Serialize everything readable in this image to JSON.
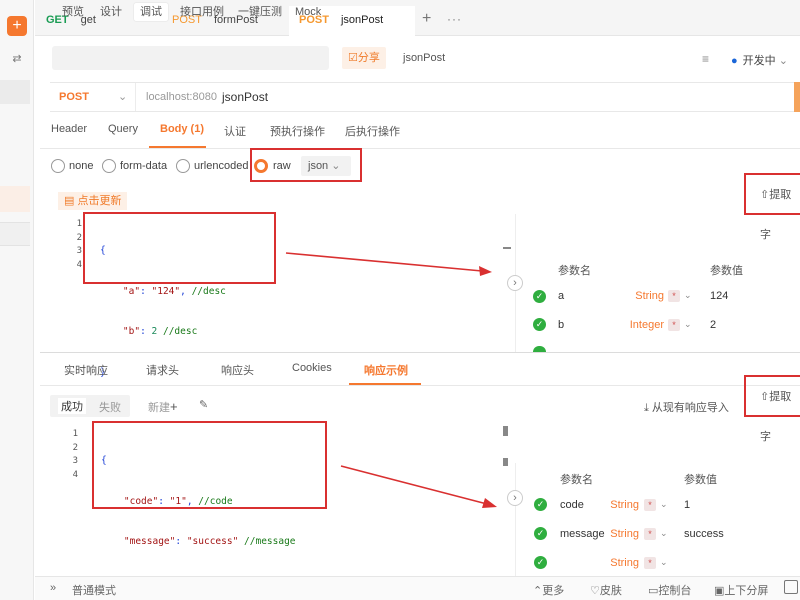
{
  "rail": {
    "add_icon": "plus-icon",
    "tool_icon": "sliders-icon"
  },
  "tabs": [
    {
      "method": "GET",
      "name": "get"
    },
    {
      "method": "POST",
      "name": "formPost"
    },
    {
      "method": "POST",
      "name": "jsonPost"
    }
  ],
  "tab_add": "+",
  "tab_more": "···",
  "modes": [
    "预览",
    "设计",
    "调试",
    "接口用例",
    "一键压测",
    "Mock"
  ],
  "share": "☑分享",
  "doc_name": "jsonPost",
  "env": "开发中",
  "env_chev": "⌄",
  "request": {
    "method": "POST",
    "host": "localhost:8080",
    "path": "jsonPost"
  },
  "req_tabs": [
    "Header",
    "Query",
    "Body (1)",
    "认证",
    "预执行操作",
    "后执行操作"
  ],
  "body_types": [
    "none",
    "form-data",
    "urlencoded",
    "raw"
  ],
  "raw_format": "json",
  "refresh_btn": "点击更新",
  "extract_label": "提取字",
  "request_code_lines": [
    "1",
    "2",
    "3",
    "4"
  ],
  "request_code": {
    "l1": "{",
    "l2_key": "\"a\"",
    "l2_val": "\"124\"",
    "l2_cmt": "//desc",
    "l3_key": "\"b\"",
    "l3_val": "2",
    "l3_cmt": "//desc",
    "l4": "}"
  },
  "param_headers": {
    "name": "参数名",
    "value": "参数值"
  },
  "request_params": [
    {
      "name": "a",
      "type": "String",
      "value": "124"
    },
    {
      "name": "b",
      "type": "Integer",
      "value": "2"
    }
  ],
  "resp_tabs": [
    "实时响应",
    "请求头",
    "响应头",
    "Cookies",
    "响应示例"
  ],
  "status_tabs": {
    "success": "成功",
    "fail": "失败"
  },
  "new_btn": "新建",
  "import_btn": "从现有响应导入",
  "response_code_lines": [
    "1",
    "2",
    "3",
    "4"
  ],
  "response_code": {
    "l1": "{",
    "l2_key": "\"code\"",
    "l2_val": "\"1\"",
    "l2_cmt": "//code",
    "l3_key": "\"message\"",
    "l3_val": "\"success\"",
    "l3_cmt": "//message",
    "l4": "}"
  },
  "response_params": [
    {
      "name": "code",
      "type": "String",
      "value": "1"
    },
    {
      "name": "message",
      "type": "String",
      "value": "success"
    },
    {
      "name": "",
      "type": "String",
      "value": ""
    }
  ],
  "statusbar": {
    "mode": "普通模式",
    "more": "更多",
    "skin": "皮肤",
    "console": "控制台",
    "split": "上下分屏"
  },
  "colors": {
    "accent": "#f5782f",
    "get": "#1a9c54",
    "ok": "#2fae3f",
    "annotation": "#d93030"
  }
}
